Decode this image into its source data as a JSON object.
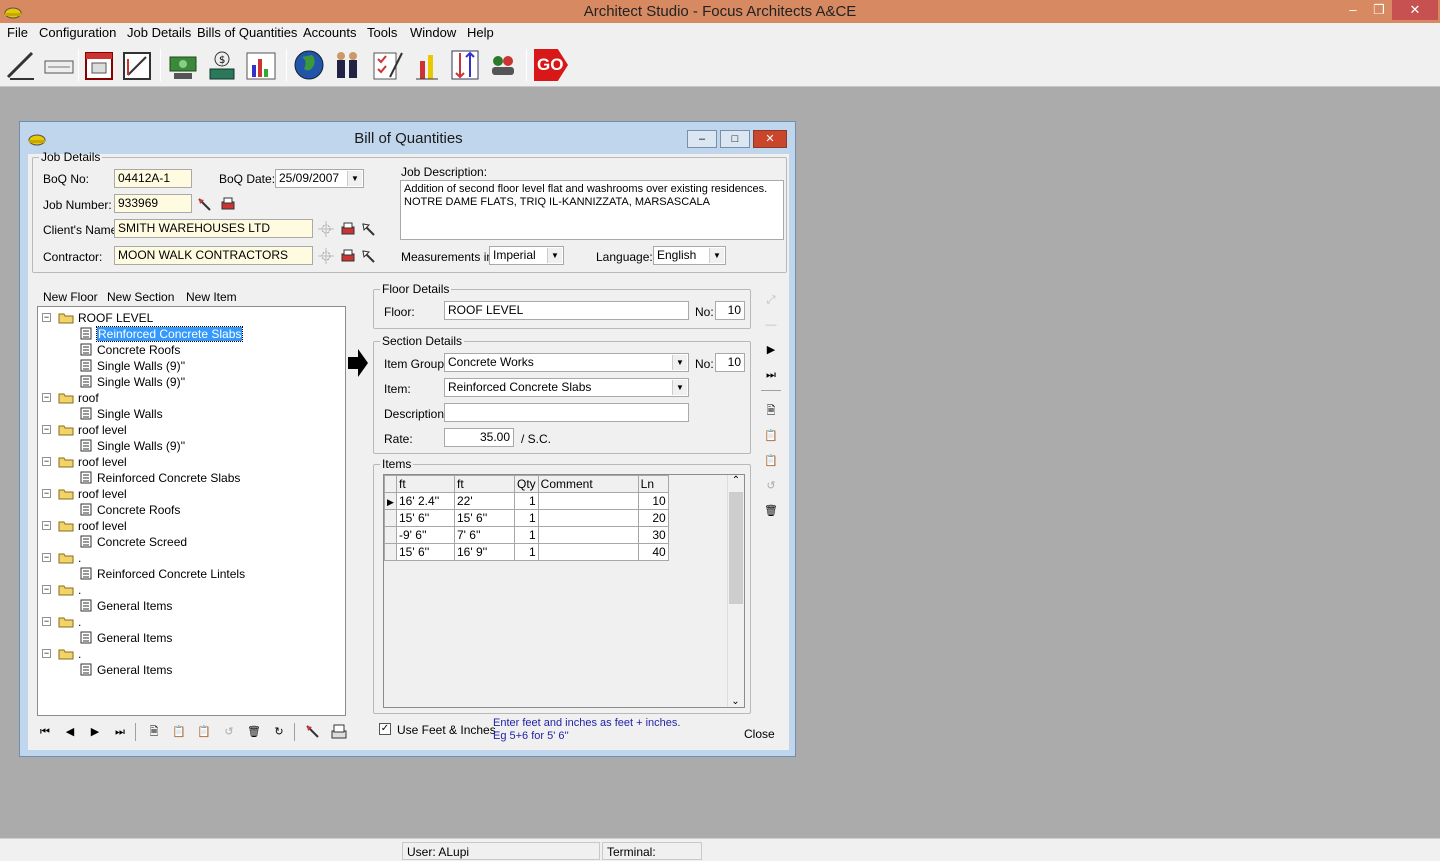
{
  "app": {
    "title": "Architect Studio - Focus Architects A&CE"
  },
  "menu": [
    "File",
    "Configuration",
    "Job Details",
    "Bills of Quantities",
    "Accounts",
    "Tools",
    "Window",
    "Help"
  ],
  "toolbar": {
    "icons": [
      "draw-icon",
      "keyboard-icon",
      "calendar-icon",
      "drawing-board-icon",
      "money-icon",
      "cash-register-icon",
      "chart-icon",
      "globe-icon",
      "people-icon",
      "checklist-icon",
      "thermometer-icon",
      "sort-icon",
      "users-icon",
      "go-icon"
    ],
    "go_label": "GO"
  },
  "dialog": {
    "title": "Bill of Quantities",
    "job_details": {
      "legend": "Job Details",
      "boq_no_label": "BoQ No:",
      "boq_no": "04412A-1",
      "boq_date_label": "BoQ Date:",
      "boq_date": "25/09/2007",
      "job_number_label": "Job Number:",
      "job_number": "933969",
      "client_label": "Client's Name:",
      "client": "SMITH WAREHOUSES LTD",
      "contractor_label": "Contractor:",
      "contractor": "MOON WALK CONTRACTORS",
      "description_label": "Job Description:",
      "description_line1": "Addition of second floor level flat and washrooms over existing residences.",
      "description_line2": "NOTRE DAME FLATS,  TRIQ IL-KANNIZZATA, MARSASCALA",
      "measurements_label": "Measurements in:",
      "measurements": "Imperial",
      "language_label": "Language:",
      "language": "English"
    },
    "tree_actions": [
      "New Floor",
      "New Section",
      "New Item"
    ],
    "tree": [
      {
        "level": 0,
        "label": "ROOF LEVEL"
      },
      {
        "level": 1,
        "label": "Reinforced Concrete Slabs",
        "selected": true
      },
      {
        "level": 1,
        "label": "Concrete Roofs"
      },
      {
        "level": 1,
        "label": "Single Walls (9)''"
      },
      {
        "level": 1,
        "label": "Single Walls (9)''"
      },
      {
        "level": 0,
        "label": "roof"
      },
      {
        "level": 1,
        "label": "Single Walls"
      },
      {
        "level": 0,
        "label": "roof level"
      },
      {
        "level": 1,
        "label": "Single Walls (9)''"
      },
      {
        "level": 0,
        "label": "roof level"
      },
      {
        "level": 1,
        "label": "Reinforced Concrete Slabs"
      },
      {
        "level": 0,
        "label": "roof level"
      },
      {
        "level": 1,
        "label": "Concrete Roofs"
      },
      {
        "level": 0,
        "label": "roof level"
      },
      {
        "level": 1,
        "label": "Concrete Screed"
      },
      {
        "level": 0,
        "label": "."
      },
      {
        "level": 1,
        "label": "Reinforced Concrete Lintels"
      },
      {
        "level": 0,
        "label": "."
      },
      {
        "level": 1,
        "label": "General Items"
      },
      {
        "level": 0,
        "label": "."
      },
      {
        "level": 1,
        "label": "General Items"
      },
      {
        "level": 0,
        "label": "."
      },
      {
        "level": 1,
        "label": "General Items"
      }
    ],
    "floor": {
      "legend": "Floor Details",
      "floor_label": "Floor:",
      "floor": "ROOF LEVEL",
      "no_label": "No:",
      "no": "10"
    },
    "section": {
      "legend": "Section Details",
      "item_group_label": "Item Group:",
      "item_group": "Concrete Works",
      "no_label": "No:",
      "no": "10",
      "item_label": "Item:",
      "item": "Reinforced Concrete Slabs",
      "description_label": "Description:",
      "description": "",
      "rate_label": "Rate:",
      "rate": "35.00",
      "rate_unit": "/  S.C."
    },
    "items": {
      "legend": "Items",
      "columns": [
        "ft",
        "ft",
        "Qty",
        "Comment",
        "Ln"
      ],
      "rows": [
        [
          "16' 2.4''",
          "22'",
          "1",
          "",
          "10"
        ],
        [
          "15' 6''",
          "15' 6''",
          "1",
          "",
          "20"
        ],
        [
          "-9' 6''",
          "7' 6''",
          "1",
          "",
          "30"
        ],
        [
          "15' 6''",
          "16' 9''",
          "1",
          "",
          "40"
        ]
      ]
    },
    "use_feet_label": "Use Feet & Inches",
    "use_feet_checked": true,
    "hint_line1": "Enter feet and inches as feet + inches.",
    "hint_line2": "Eg 5+6 for 5' 6''",
    "close_label": "Close"
  },
  "status": {
    "user": "User: ALupi",
    "terminal": "Terminal:"
  }
}
